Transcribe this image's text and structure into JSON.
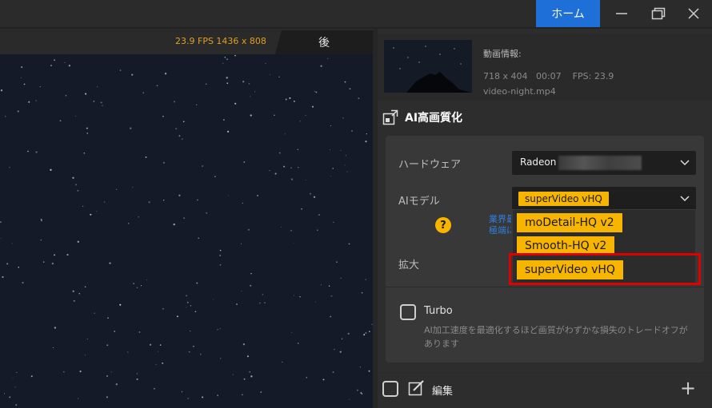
{
  "titlebar": {
    "home_label": "ホーム",
    "controls": [
      "minimize-icon",
      "restore-icon",
      "close-icon"
    ]
  },
  "preview": {
    "fps_info": "23.9 FPS  1436 x 808",
    "tab_after": "後"
  },
  "video_info": {
    "label": "動画情報:",
    "meta": "718 x 404   00:07    FPS: 23.9",
    "filename": "video-night.mp4"
  },
  "ai": {
    "title": "AI高画質化",
    "hardware_label": "ハードウェア",
    "hardware_value": "Radeon",
    "model_label": "AIモデル",
    "model_value": "superVideo vHQ",
    "hint_text": "業界最\n極端に",
    "scale_label": "拡大",
    "turbo_label": "Turbo",
    "turbo_desc": "AI加工速度を最適化するほど画質がわずかな損失のトレードオフがあります"
  },
  "dropdown": {
    "options": [
      "moDetail-HQ  v2",
      "Smooth-HQ  v2",
      "superVideo vHQ"
    ],
    "highlighted_index": 2
  },
  "edit": {
    "label": "編集",
    "plus": "+"
  },
  "colors": {
    "accent": "#f7b500",
    "home_button": "#1f6fd9",
    "highlight_box": "#e00000",
    "fps_text": "#e0a020"
  }
}
